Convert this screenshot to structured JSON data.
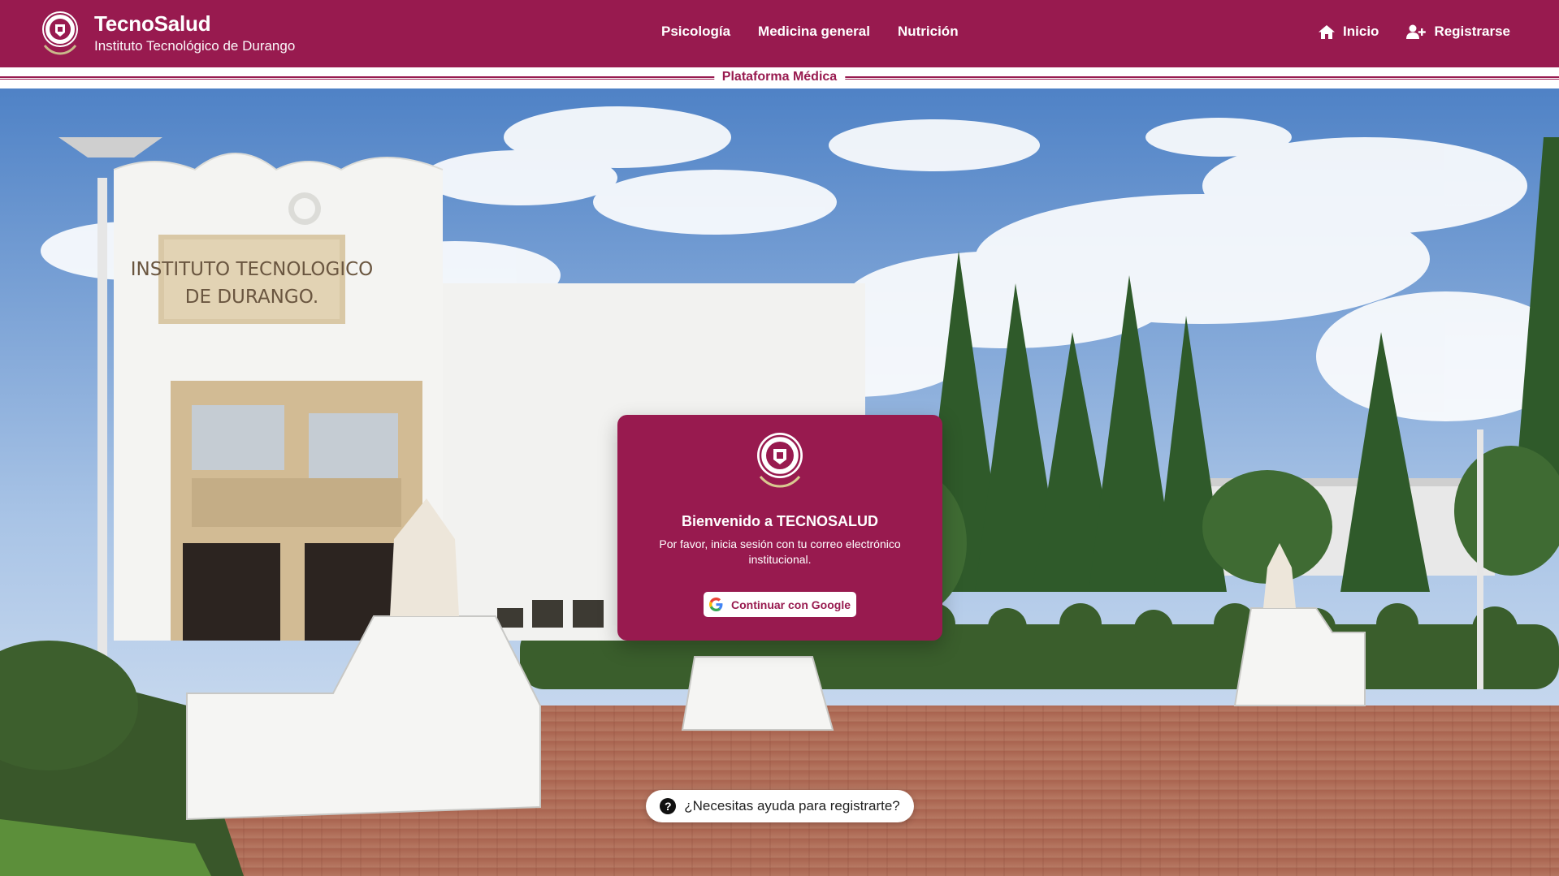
{
  "header": {
    "title": "TecnoSalud",
    "subtitle": "Instituto Tecnológico de Durango",
    "nav": [
      "Psicología",
      "Medicina general",
      "Nutrición"
    ],
    "inicio": "Inicio",
    "registrarse": "Registrarse",
    "icons": {
      "inicio": "home-icon",
      "registrarse": "user-plus-icon"
    },
    "color": "#981a4f"
  },
  "band": {
    "label": "Plataforma Médica"
  },
  "hero": {
    "sign": [
      "INSTITUTO TECNOLOGICO",
      "DE DURANGO."
    ]
  },
  "card": {
    "title": "Bienvenido a TECNOSALUD",
    "text": "Por favor, inicia sesión con tu correo electrónico institucional.",
    "button": "Continuar con Google",
    "button_icon": "google-icon"
  },
  "help": {
    "text": "¿Necesitas ayuda para registrarte?",
    "icon": "question-circle-icon"
  }
}
